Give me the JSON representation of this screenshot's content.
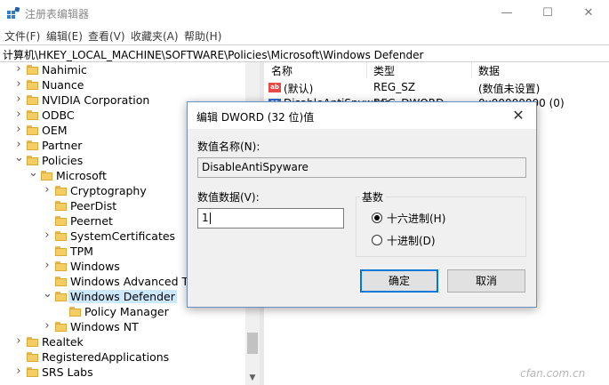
{
  "window": {
    "title": "注册表编辑器",
    "min_glyph": "—",
    "max_glyph": "☐",
    "close_glyph": "✕"
  },
  "menu": [
    "文件(F)",
    "编辑(E)",
    "查看(V)",
    "收藏夹(A)",
    "帮助(H)"
  ],
  "address": "计算机\\HKEY_LOCAL_MACHINE\\SOFTWARE\\Policies\\Microsoft\\Windows Defender",
  "tree": [
    {
      "label": "Nahimic",
      "arrow": ">"
    },
    {
      "label": "Nuance",
      "arrow": ">"
    },
    {
      "label": "NVIDIA Corporation",
      "arrow": ">"
    },
    {
      "label": "ODBC",
      "arrow": ">"
    },
    {
      "label": "OEM",
      "arrow": ">"
    },
    {
      "label": "Partner",
      "arrow": ">"
    },
    {
      "label": "Policies",
      "arrow": "v"
    },
    {
      "label": "Microsoft",
      "arrow": "v"
    },
    {
      "label": "Cryptography",
      "arrow": ">"
    },
    {
      "label": "PeerDist",
      "arrow": ""
    },
    {
      "label": "Peernet",
      "arrow": ""
    },
    {
      "label": "SystemCertificates",
      "arrow": ">"
    },
    {
      "label": "TPM",
      "arrow": ""
    },
    {
      "label": "Windows",
      "arrow": ">"
    },
    {
      "label": "Windows Advanced Threat Protection",
      "arrow": ""
    },
    {
      "label": "Windows Defender",
      "arrow": "v",
      "selected": true
    },
    {
      "label": "Policy Manager",
      "arrow": ""
    },
    {
      "label": "Windows NT",
      "arrow": ">"
    },
    {
      "label": "Realtek",
      "arrow": ">"
    },
    {
      "label": "RegisteredApplications",
      "arrow": ""
    },
    {
      "label": "SRS Labs",
      "arrow": ">"
    }
  ],
  "list": {
    "columns": [
      "名称",
      "类型",
      "数据"
    ],
    "rows": [
      {
        "icon": "string-value-icon",
        "name": "(默认)",
        "type": "REG_SZ",
        "data": "(数值未设置)"
      },
      {
        "icon": "dword-value-icon",
        "name": "DisableAntiSpyware",
        "type": "REG_DWORD",
        "data": "0x00000000 (0)"
      }
    ]
  },
  "dialog": {
    "title": "编辑 DWORD (32 位)值",
    "name_label": "数值名称(N):",
    "name_value": "DisableAntiSpyware",
    "data_label": "数值数据(V):",
    "data_value": "1",
    "radix_label": "基数",
    "radix_options": [
      {
        "label": "十六进制(H)",
        "checked": true
      },
      {
        "label": "十进制(D)",
        "checked": false
      }
    ],
    "ok": "确定",
    "cancel": "取消"
  },
  "watermark": "cfan.com.cn"
}
